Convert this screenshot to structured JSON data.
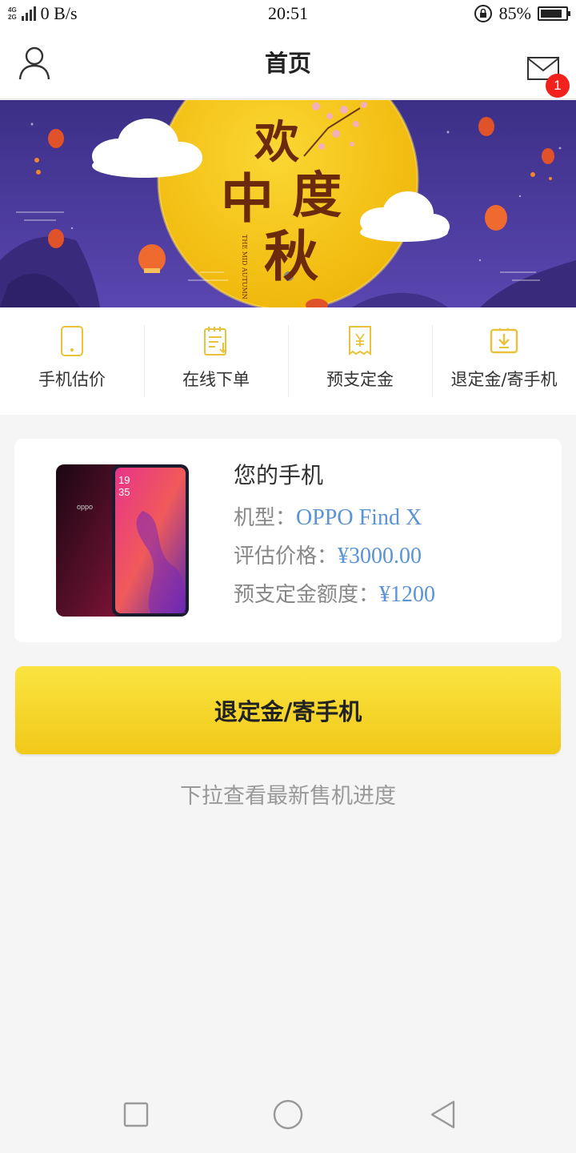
{
  "status_bar": {
    "network_types": [
      "4G",
      "2G"
    ],
    "speed": "0 B/s",
    "time": "20:51",
    "battery": "85%",
    "battery_level": 0.85
  },
  "header": {
    "title": "首页",
    "message_badge": "1"
  },
  "banner": {
    "title_chars": [
      "欢",
      "度",
      "中",
      "秋"
    ],
    "subtitle_lines": [
      "THE MID",
      "AUTUMN"
    ],
    "colors": {
      "sky": "#4a3a9a",
      "moon": "#f5c516"
    }
  },
  "menu": {
    "items": [
      {
        "label": "手机估价",
        "icon": "phone-icon"
      },
      {
        "label": "在线下单",
        "icon": "order-form-icon"
      },
      {
        "label": "预支定金",
        "icon": "yen-receipt-icon"
      },
      {
        "label": "退定金/寄手机",
        "icon": "box-download-icon"
      }
    ],
    "icon_color": "#e8c23a"
  },
  "phone_card": {
    "title": "您的手机",
    "model_label": "机型：",
    "model_value": "OPPO Find X",
    "price_label": "评估价格：",
    "price_value": "¥3000.00",
    "deposit_label": "预支定金额度：",
    "deposit_value": "¥1200",
    "phone_screen_time": [
      "19",
      "35"
    ],
    "phone_brand": "oppo"
  },
  "action_button": {
    "label": "退定金/寄手机",
    "color": "#f5d322"
  },
  "hint": "下拉查看最新售机进度",
  "navbar": {
    "buttons": [
      "recent-apps",
      "home",
      "back"
    ]
  }
}
